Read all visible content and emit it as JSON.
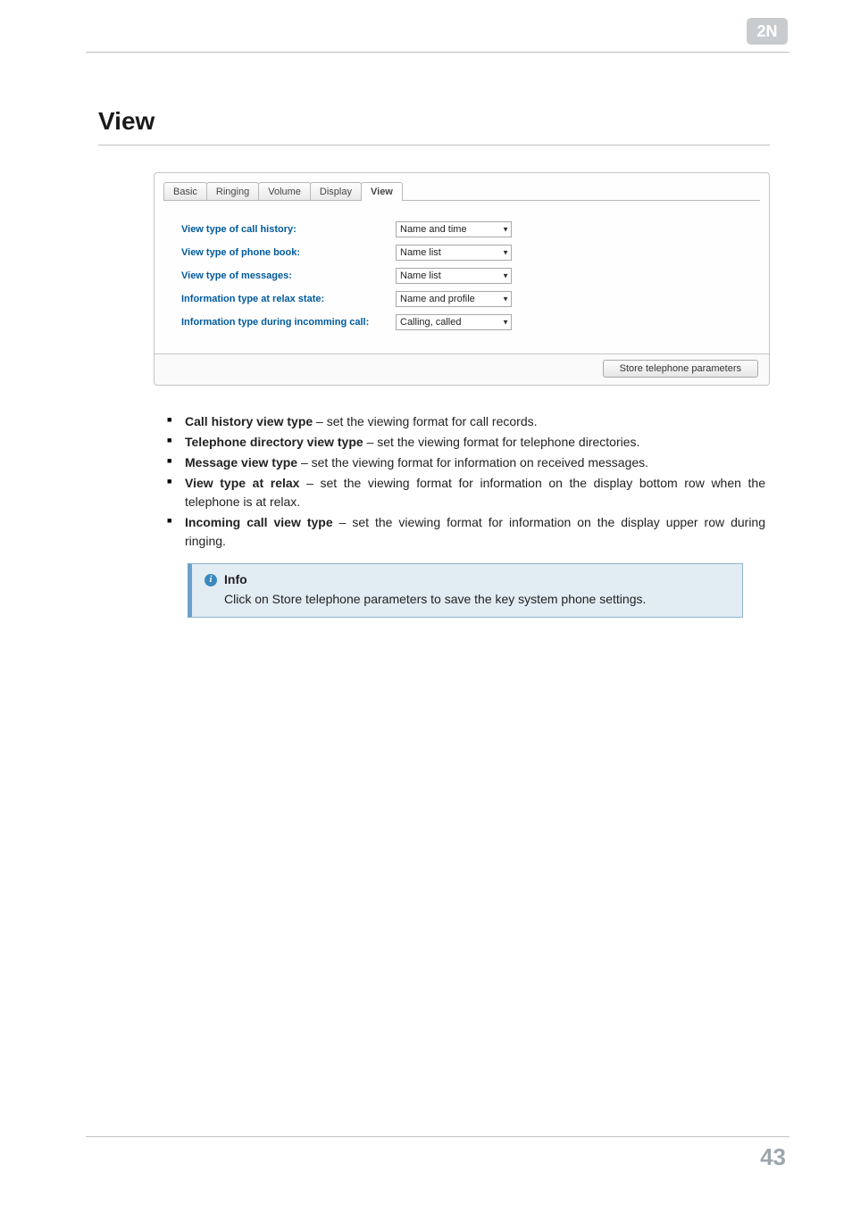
{
  "logo": {
    "name": "2N"
  },
  "title": "View",
  "panel": {
    "tabs": [
      {
        "label": "Basic",
        "active": false
      },
      {
        "label": "Ringing",
        "active": false
      },
      {
        "label": "Volume",
        "active": false
      },
      {
        "label": "Display",
        "active": false
      },
      {
        "label": "View",
        "active": true
      }
    ],
    "rows": [
      {
        "label": "View type of call history:",
        "value": "Name and time"
      },
      {
        "label": "View type of phone book:",
        "value": "Name list"
      },
      {
        "label": "View type of messages:",
        "value": "Name list"
      },
      {
        "label": "Information type at relax state:",
        "value": "Name and profile"
      },
      {
        "label": "Information type during incomming call:",
        "value": "Calling, called"
      }
    ],
    "store_button": "Store telephone parameters"
  },
  "bullets": [
    {
      "bold": "Call history view type",
      "rest": " – set the viewing format for call records."
    },
    {
      "bold": "Telephone directory view type",
      "rest": " – set the viewing format for telephone directories."
    },
    {
      "bold": "Message view type",
      "rest": " – set the viewing format for information on received messages."
    },
    {
      "bold": "View type at relax",
      "rest": " – set the viewing format for information on the display bottom row when the telephone is at relax."
    },
    {
      "bold": "Incoming call view type",
      "rest": " – set the viewing format for information on the display upper row during ringing."
    }
  ],
  "info": {
    "title": "Info",
    "body": "Click on Store telephone parameters to save the key system phone settings."
  },
  "page_number": "43"
}
